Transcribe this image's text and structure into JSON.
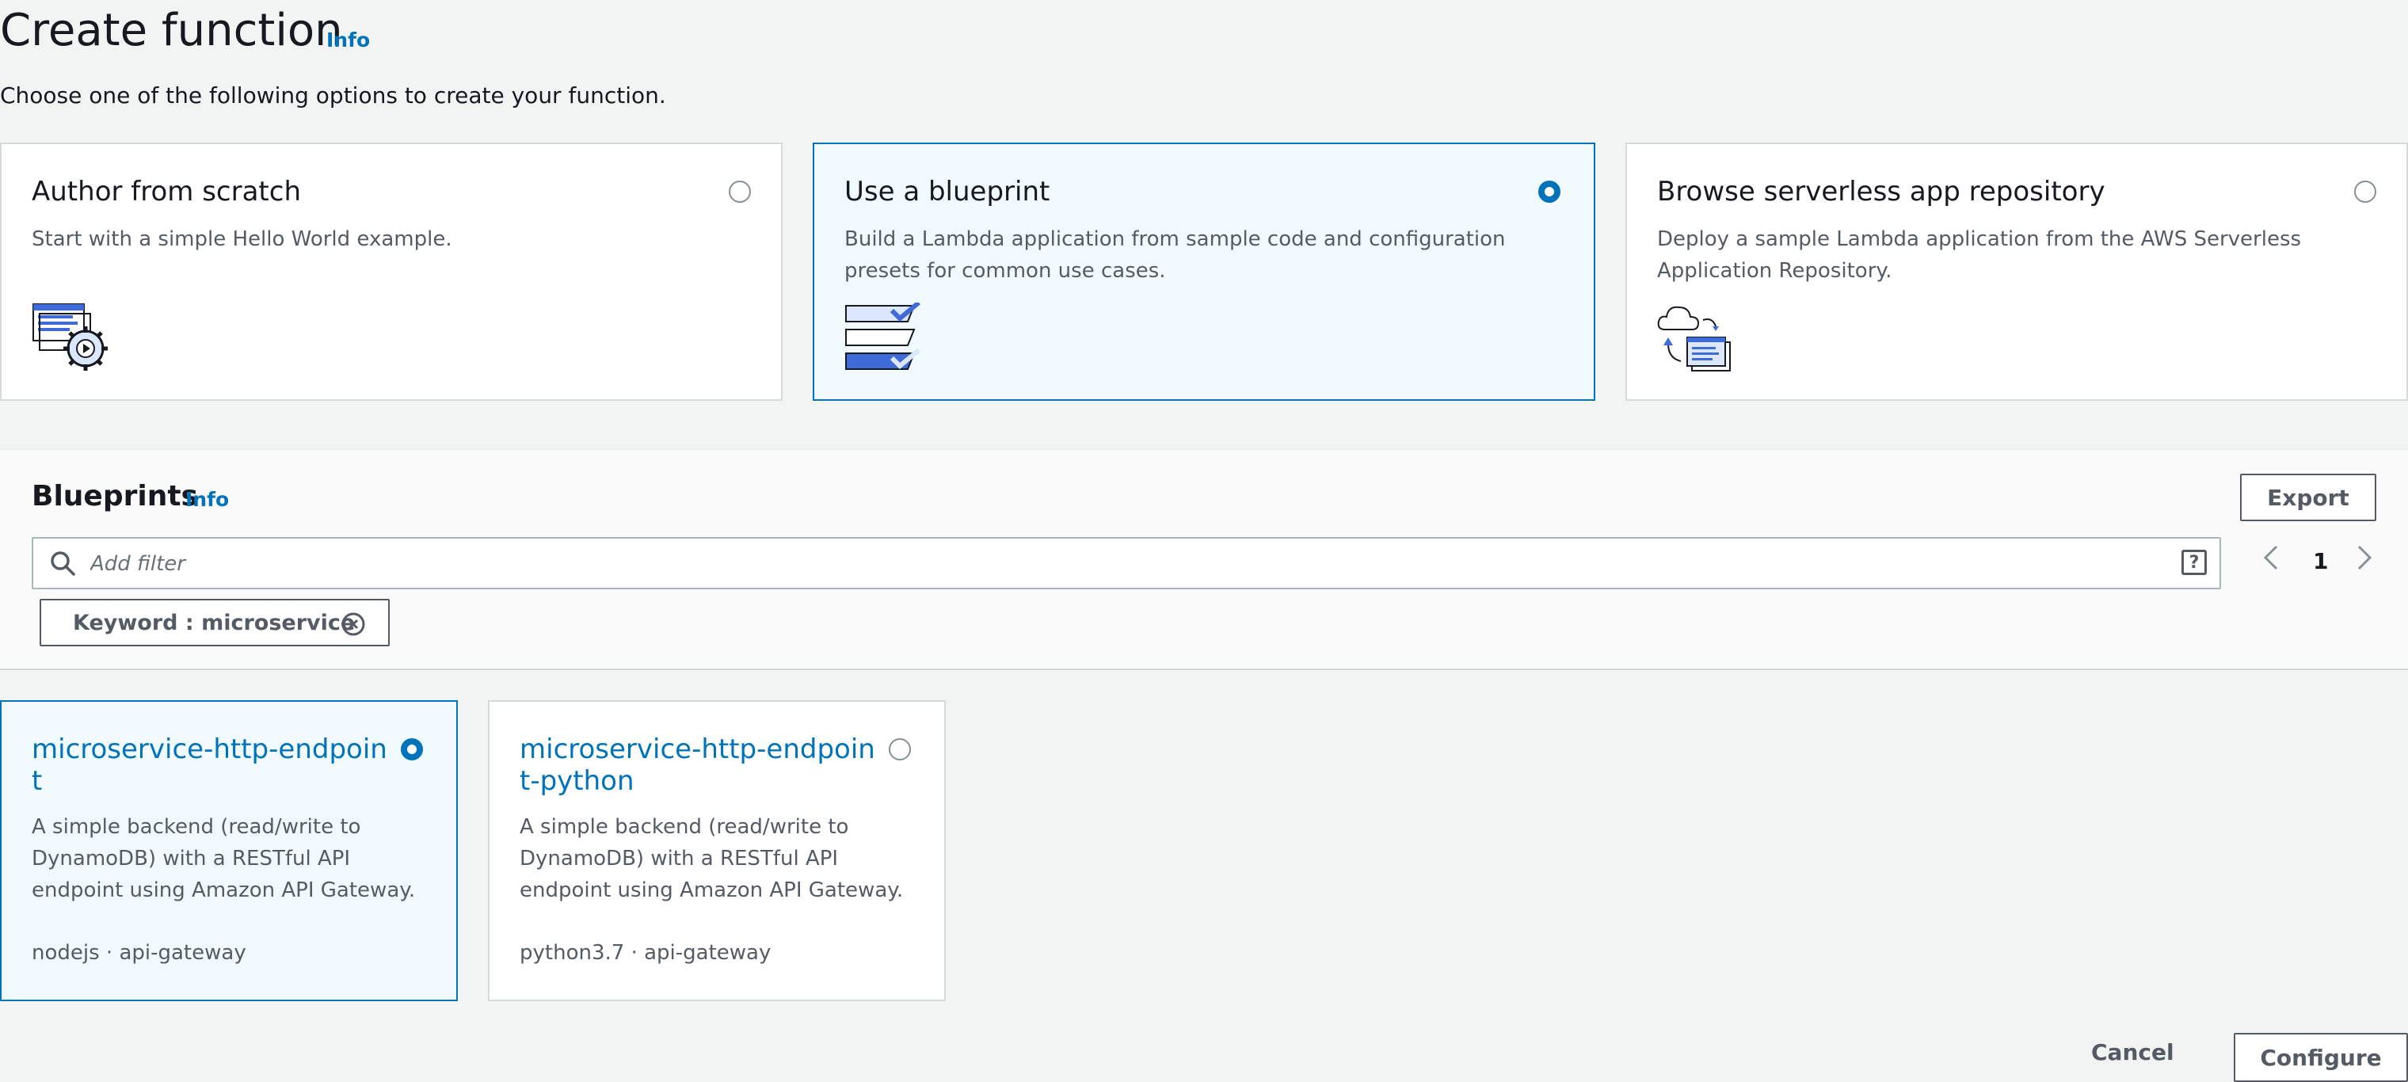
{
  "header": {
    "title": "Create function",
    "info_label": "Info",
    "subtitle": "Choose one of the following options to create your function."
  },
  "options": [
    {
      "title": "Author from scratch",
      "description": "Start with a simple Hello World example.",
      "selected": false,
      "icon": "code-gear-icon"
    },
    {
      "title": "Use a blueprint",
      "description": "Build a Lambda application from sample code and configuration presets for common use cases.",
      "selected": true,
      "icon": "blueprint-checklist-icon"
    },
    {
      "title": "Browse serverless app repository",
      "description": "Deploy a sample Lambda application from the AWS Serverless Application Repository.",
      "selected": false,
      "icon": "cloud-repository-icon"
    }
  ],
  "blueprints": {
    "title": "Blueprints",
    "info_label": "Info",
    "export_label": "Export",
    "filter": {
      "placeholder": "Add filter",
      "value": ""
    },
    "chip_label": "Keyword : microservice",
    "page": "1",
    "items": [
      {
        "name": "microservice-http-endpoint",
        "description": "A simple backend (read/write to DynamoDB) with a RESTful API endpoint using Amazon API Gateway.",
        "tags": "nodejs · api-gateway",
        "selected": true
      },
      {
        "name": "microservice-http-endpoint-python",
        "description": "A simple backend (read/write to DynamoDB) with a RESTful API endpoint using Amazon API Gateway.",
        "tags": "python3.7 · api-gateway",
        "selected": false
      }
    ]
  },
  "footer": {
    "cancel_label": "Cancel",
    "configure_label": "Configure"
  },
  "colors": {
    "accent": "#0073bb",
    "selected_bg": "#f1faff",
    "page_bg": "#f2f3f3",
    "text_secondary": "#545b64"
  }
}
